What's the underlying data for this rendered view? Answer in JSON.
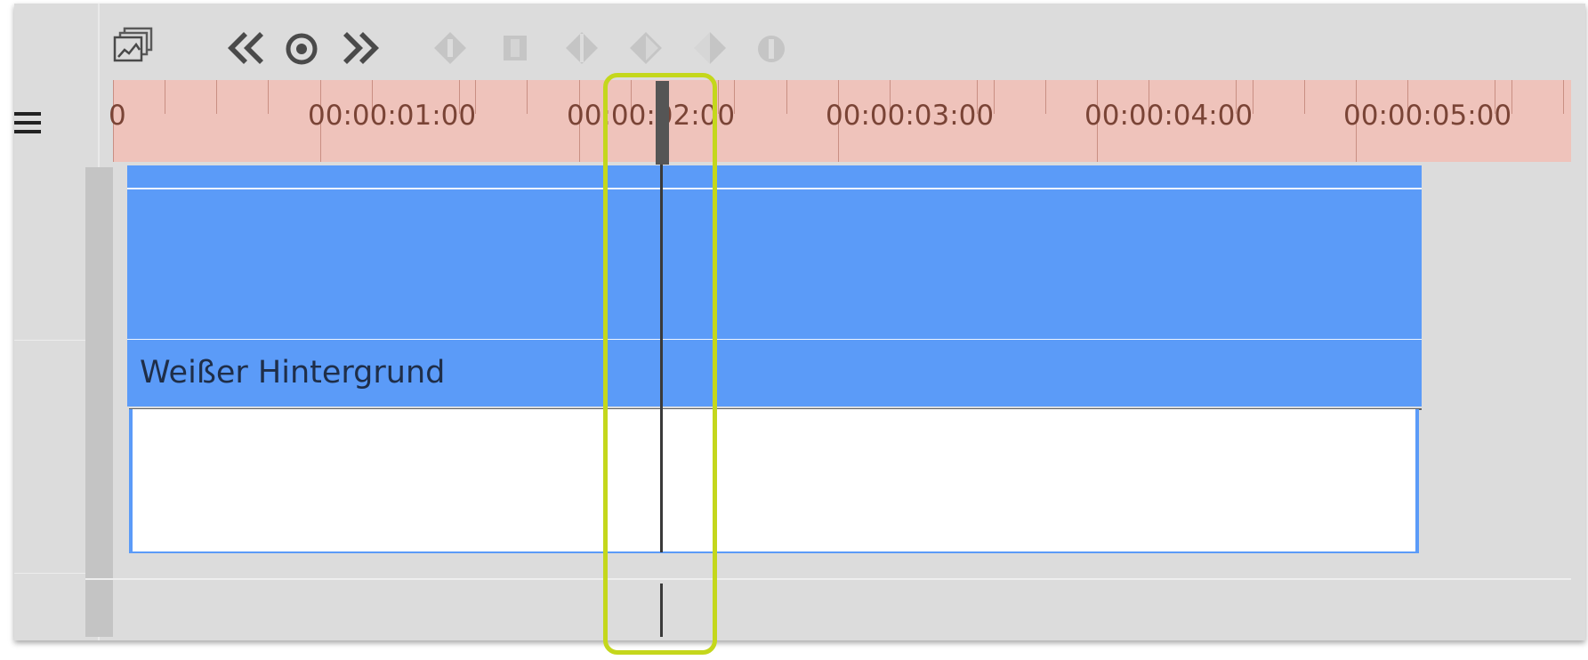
{
  "toolbar": {
    "buttons": [
      {
        "name": "image-sequence-icon",
        "kind": "image-stack"
      },
      {
        "name": "jump-previous-icon",
        "kind": "double-left"
      },
      {
        "name": "record-keyframe-icon",
        "kind": "circle-dot"
      },
      {
        "name": "jump-next-icon",
        "kind": "double-right"
      },
      {
        "name": "keyframe-in-icon",
        "kind": "diamond-bar"
      },
      {
        "name": "keyframe-hold-icon",
        "kind": "bar"
      },
      {
        "name": "keyframe-both-icon",
        "kind": "diamond-split"
      },
      {
        "name": "keyframe-ease-in-icon",
        "kind": "half-left"
      },
      {
        "name": "keyframe-ease-out-icon",
        "kind": "half-right"
      },
      {
        "name": "keyframe-out-icon",
        "kind": "circle-bar"
      }
    ],
    "active_color": "#4a4a4a",
    "disabled_color": "#c5c5c5"
  },
  "menu": {
    "icon": "hamburger-icon"
  },
  "ruler": {
    "labels": [
      "0",
      "00:00:01:00",
      "00:00:02:00",
      "00:00:03:00",
      "00:00:04:00",
      "00:00:05:00"
    ],
    "background": "#efc3bb",
    "text_color": "#7a4436"
  },
  "timeline": {
    "clip_title": "Weißer Hintergrund",
    "clip_color": "#5b9bf8",
    "playhead_time": "00:00:02:00",
    "highlight_color": "#c4d71c"
  }
}
